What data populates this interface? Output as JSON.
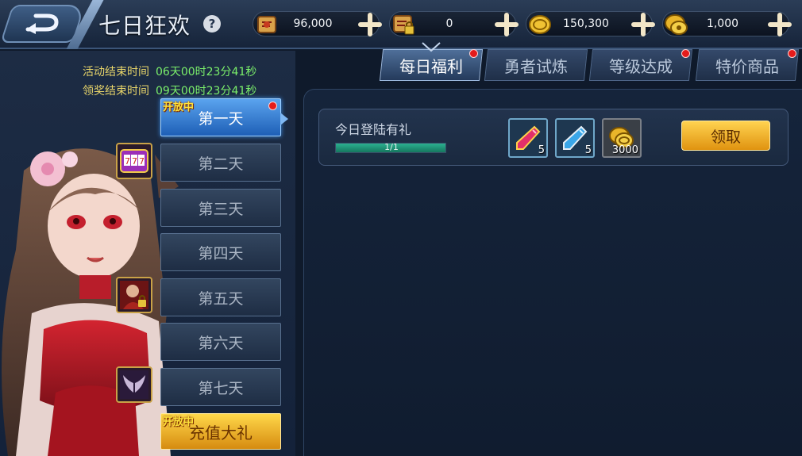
{
  "header": {
    "title": "七日狂欢",
    "help": "?",
    "resources": [
      {
        "icon": "scroll-icon",
        "value": "96,000"
      },
      {
        "icon": "locked-scroll-icon",
        "value": "0"
      },
      {
        "icon": "gold-coin-icon",
        "value": "150,300"
      },
      {
        "icon": "honor-coin-icon",
        "value": "1,000"
      }
    ]
  },
  "timers": {
    "activity_label": "活动结束时间",
    "activity_value": "06天00时23分41秒",
    "claim_label": "领奖结束时间",
    "claim_value": "09天00时23分41秒"
  },
  "days": [
    {
      "label": "第一天",
      "tag": "开放中",
      "active": true
    },
    {
      "label": "第二天"
    },
    {
      "label": "第三天"
    },
    {
      "label": "第四天"
    },
    {
      "label": "第五天"
    },
    {
      "label": "第六天"
    },
    {
      "label": "第七天"
    },
    {
      "label": "充值大礼",
      "tag": "开放中"
    }
  ],
  "tabs": [
    {
      "label": "每日福利",
      "active": true
    },
    {
      "label": "勇者试炼"
    },
    {
      "label": "等级达成"
    },
    {
      "label": "特价商品"
    }
  ],
  "task": {
    "title": "今日登陆有礼",
    "progress_text": "1/1",
    "progress": 1.0,
    "rewards": [
      {
        "icon": "red-crystal-icon",
        "count": "5"
      },
      {
        "icon": "blue-crystal-icon",
        "count": "5"
      },
      {
        "icon": "gold-coin-icon",
        "count": "3000"
      }
    ],
    "claim_label": "领取"
  }
}
